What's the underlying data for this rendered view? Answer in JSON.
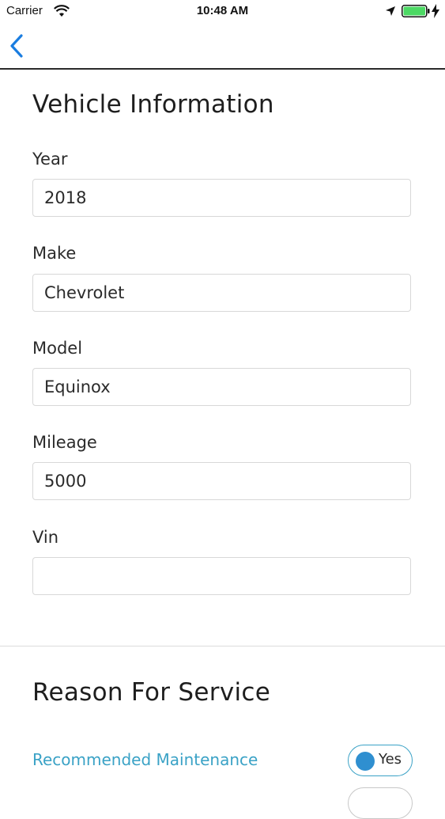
{
  "status_bar": {
    "carrier": "Carrier",
    "time": "10:48 AM",
    "battery_color": "#4cd964"
  },
  "nav": {
    "back_icon": "chevron-left-icon",
    "accent": "#1a7de0"
  },
  "vehicle_info": {
    "title": "Vehicle Information",
    "fields": [
      {
        "label": "Year",
        "value": "2018"
      },
      {
        "label": "Make",
        "value": "Chevrolet"
      },
      {
        "label": "Model",
        "value": "Equinox"
      },
      {
        "label": "Mileage",
        "value": "5000"
      },
      {
        "label": "Vin",
        "value": ""
      }
    ]
  },
  "reason_for_service": {
    "title": "Reason For Service",
    "items": [
      {
        "label": "Recommended Maintenance",
        "toggle_label": "Yes",
        "label_color": "#3aa2c6"
      }
    ]
  }
}
